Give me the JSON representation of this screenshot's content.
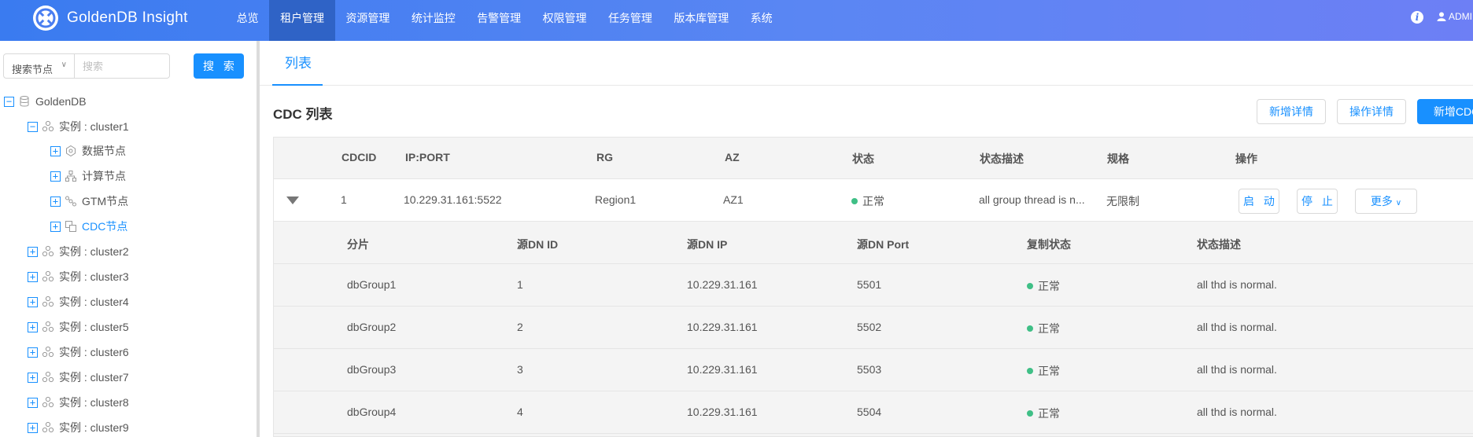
{
  "app": {
    "brand": "GoldenDB Insight",
    "user": "ADMIN"
  },
  "nav": [
    "总览",
    "租户管理",
    "资源管理",
    "统计监控",
    "告警管理",
    "权限管理",
    "任务管理",
    "版本库管理",
    "系统"
  ],
  "nav_active": "租户管理",
  "search": {
    "select_value": "搜索节点",
    "placeholder": "搜索",
    "button": "搜 索"
  },
  "tree": {
    "root": "GoldenDB",
    "cluster1": "实例 : cluster1",
    "children": [
      "数据节点",
      "计算节点",
      "GTM节点",
      "CDC节点"
    ],
    "clusters": [
      "实例 : cluster2",
      "实例 : cluster3",
      "实例 : cluster4",
      "实例 : cluster5",
      "实例 : cluster6",
      "实例 : cluster7",
      "实例 : cluster8",
      "实例 : cluster9"
    ]
  },
  "tab": "列表",
  "section": {
    "title": "CDC 列表",
    "buttons": [
      "新增详情",
      "操作详情",
      "新增CDC"
    ]
  },
  "table": {
    "headers": [
      "CDCID",
      "IP:PORT",
      "RG",
      "AZ",
      "状态",
      "状态描述",
      "规格",
      "操作"
    ],
    "row": [
      "1",
      "10.229.31.161:5522",
      "Region1",
      "AZ1",
      "正常",
      "all group thread is n...",
      "无限制"
    ],
    "actions": [
      "启 动",
      "停 止",
      "更多"
    ]
  },
  "subtable": {
    "headers": [
      "分片",
      "源DN ID",
      "源DN IP",
      "源DN Port",
      "复制状态",
      "状态描述"
    ],
    "rows": [
      [
        "dbGroup1",
        "1",
        "10.229.31.161",
        "5501",
        "正常",
        "all thd is normal."
      ],
      [
        "dbGroup2",
        "2",
        "10.229.31.161",
        "5502",
        "正常",
        "all thd is normal."
      ],
      [
        "dbGroup3",
        "3",
        "10.229.31.161",
        "5503",
        "正常",
        "all thd is normal."
      ],
      [
        "dbGroup4",
        "4",
        "10.229.31.161",
        "5504",
        "正常",
        "all thd is normal."
      ]
    ]
  },
  "colors": {
    "accent": "#1890ff",
    "status_ok": "#3fbf86",
    "topbar": "#4a7ef1"
  }
}
